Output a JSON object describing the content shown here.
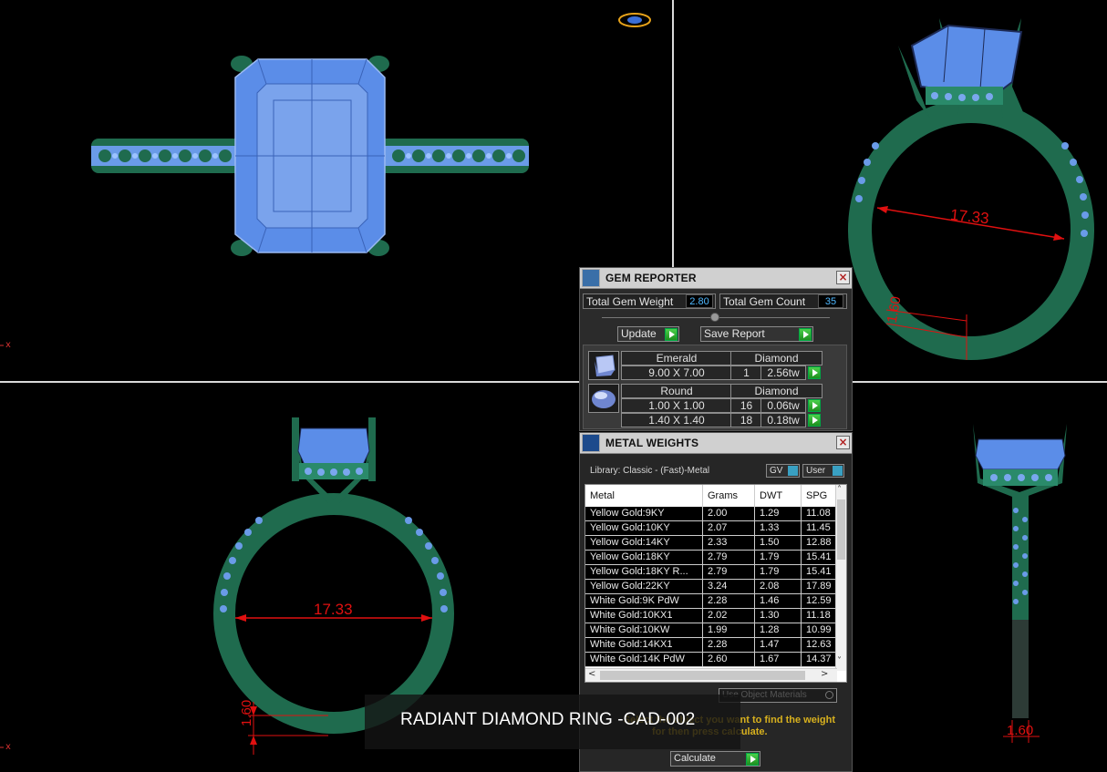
{
  "viewport": {
    "axis_label_top": "x",
    "axis_label_bottom": "x",
    "dimensions": {
      "top_right_diameter": "17.33",
      "top_right_thickness": "1.60",
      "bottom_left_diameter": "17.33",
      "bottom_left_thickness": "1.60",
      "bottom_right_width": "1.60"
    },
    "caption": "RADIANT DIAMOND RING -CAD-002"
  },
  "gem_reporter": {
    "title": "GEM REPORTER",
    "total_gem_weight_label": "Total Gem Weight",
    "total_gem_weight_value": "2.80",
    "total_gem_count_label": "Total Gem Count",
    "total_gem_count_value": "35",
    "update_label": "Update",
    "save_report_label": "Save Report",
    "groups": [
      {
        "shape": "Emerald",
        "material": "Diamond",
        "rows": [
          {
            "size": "9.00 X 7.00",
            "count": "1",
            "weight": "2.56tw"
          }
        ]
      },
      {
        "shape": "Round",
        "material": "Diamond",
        "rows": [
          {
            "size": "1.00 X 1.00",
            "count": "16",
            "weight": "0.06tw"
          },
          {
            "size": "1.40 X 1.40",
            "count": "18",
            "weight": "0.18tw"
          }
        ]
      }
    ]
  },
  "metal_weights": {
    "title": "METAL WEIGHTS",
    "library": "Library: Classic - (Fast)-Metal",
    "toggle_gv": "GV",
    "toggle_user": "User",
    "columns": [
      "Metal",
      "Grams",
      "DWT",
      "SPG"
    ],
    "rows": [
      [
        "Yellow Gold:9KY",
        "2.00",
        "1.29",
        "11.08"
      ],
      [
        "Yellow Gold:10KY",
        "2.07",
        "1.33",
        "11.45"
      ],
      [
        "Yellow Gold:14KY",
        "2.33",
        "1.50",
        "12.88"
      ],
      [
        "Yellow Gold:18KY",
        "2.79",
        "1.79",
        "15.41"
      ],
      [
        "Yellow Gold:18KY R...",
        "2.79",
        "1.79",
        "15.41"
      ],
      [
        "Yellow Gold:22KY",
        "3.24",
        "2.08",
        "17.89"
      ],
      [
        "White Gold:9K PdW",
        "2.28",
        "1.46",
        "12.59"
      ],
      [
        "White Gold:10KX1",
        "2.02",
        "1.30",
        "11.18"
      ],
      [
        "White Gold:10KW",
        "1.99",
        "1.28",
        "10.99"
      ],
      [
        "White Gold:14KX1",
        "2.28",
        "1.47",
        "12.63"
      ],
      [
        "White Gold:14K PdW",
        "2.60",
        "1.67",
        "14.37"
      ]
    ],
    "use_object_materials": "Use Object Materials",
    "hint_line1": "Select the object you want to find the weight",
    "hint_line2": "for then press calculate.",
    "calculate_label": "Calculate"
  },
  "colors": {
    "metal": "#1f6b4e",
    "gem": "#5b8de8",
    "dimension": "#e01010",
    "value_text": "#4fb8ff"
  }
}
